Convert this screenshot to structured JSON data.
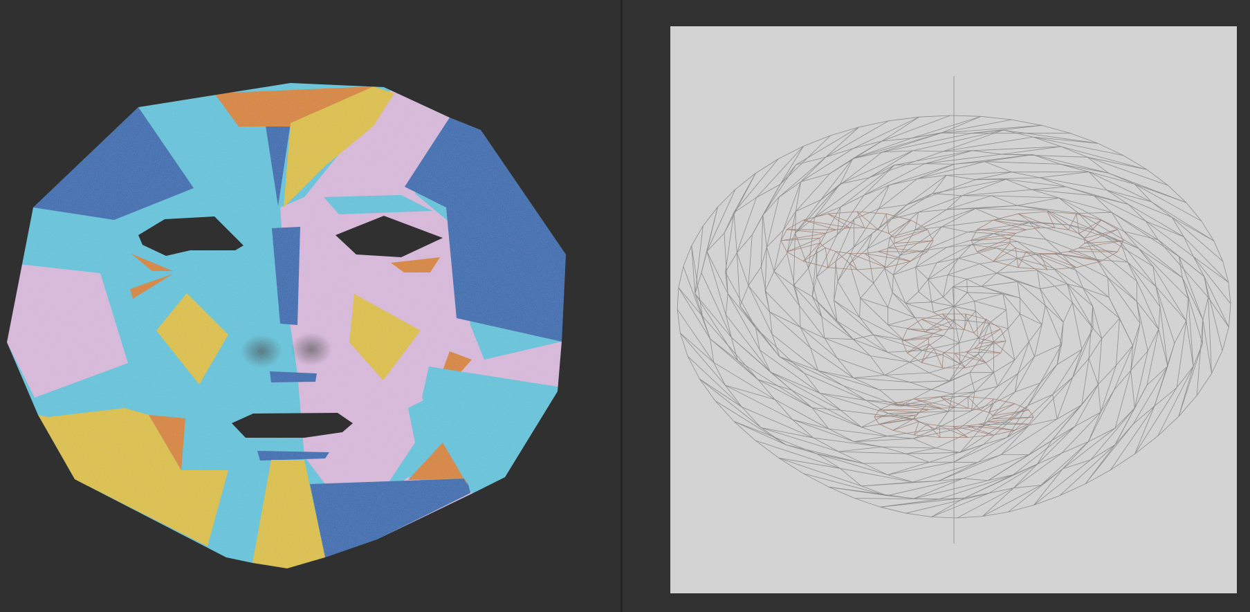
{
  "viewport": {
    "object": "painted-face-mask",
    "palette": {
      "background": "#303030",
      "cyan": "#5ec1d8",
      "blue": "#2d67ad",
      "lilac": "#d5b6d8",
      "yellow": "#d9bd3e",
      "orange": "#d4812f",
      "cutout": "#303030"
    }
  },
  "uv_editor": {
    "texture_background": "#d3d3d3",
    "wire_color": "#8c8c8c",
    "detail_wire_color": "#a08478"
  }
}
